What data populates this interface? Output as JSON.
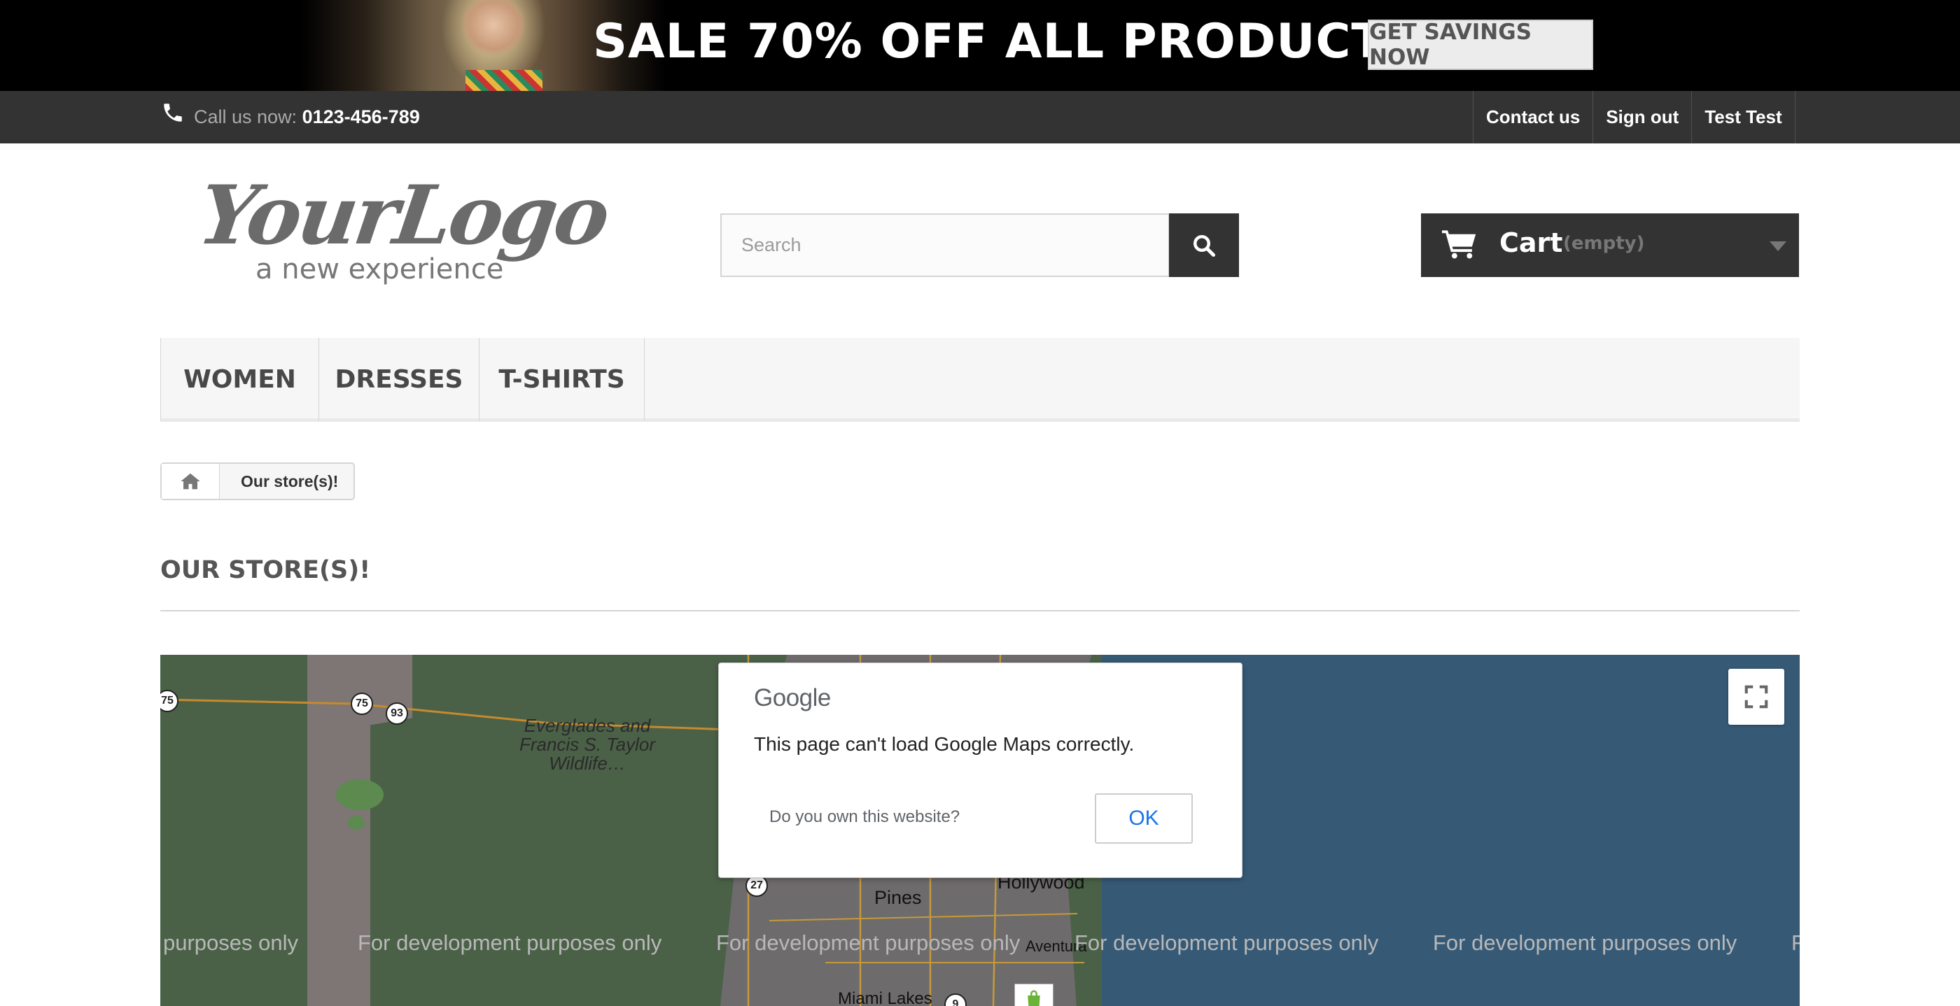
{
  "banner": {
    "headline": "SALE 70% OFF ALL PRODUCTS",
    "button_label": "GET SAVINGS NOW"
  },
  "topbar": {
    "call_prefix": "Call us now: ",
    "phone_number": "0123-456-789",
    "links": [
      "Contact us",
      "Sign out",
      "Test Test"
    ]
  },
  "header": {
    "logo_main": "YourLogo",
    "logo_sub": "a new experience",
    "search_placeholder": "Search",
    "cart_label": "Cart",
    "cart_status": "(empty)"
  },
  "menu": {
    "items": [
      "WOMEN",
      "DRESSES",
      "T-SHIRTS"
    ]
  },
  "breadcrumb": {
    "current": "Our store(s)!"
  },
  "page": {
    "heading": "OUR STORE(S)!"
  },
  "map": {
    "labels": {
      "park": "Everglades and Francis S. Taylor Wildlife…",
      "city_hollywood": "Hollywood",
      "city_pines": "Pines",
      "city_miami_lakes": "Miami Lakes",
      "city_aventura": "Aventura"
    },
    "shields": [
      "75",
      "75",
      "93",
      "27",
      "9"
    ],
    "watermark": "For development purposes only",
    "watermark_partial": "purposes only",
    "watermark_tail": "F"
  },
  "dialog": {
    "brand": "Google",
    "message": "This page can't load Google Maps correctly.",
    "own_site": "Do you own this website?",
    "ok_label": "OK",
    "ok_color": "#1a73e8"
  },
  "colors": {
    "dark_bar": "#333333",
    "land": "#4a6147",
    "sea": "#365a76"
  }
}
